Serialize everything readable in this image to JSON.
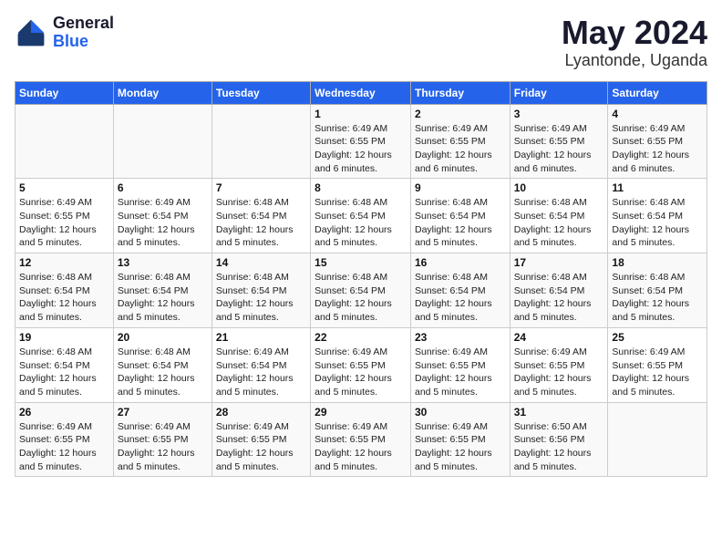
{
  "header": {
    "logo_general": "General",
    "logo_blue": "Blue",
    "title": "May 2024",
    "subtitle": "Lyantonde, Uganda"
  },
  "weekdays": [
    "Sunday",
    "Monday",
    "Tuesday",
    "Wednesday",
    "Thursday",
    "Friday",
    "Saturday"
  ],
  "weeks": [
    [
      {
        "day": "",
        "info": ""
      },
      {
        "day": "",
        "info": ""
      },
      {
        "day": "",
        "info": ""
      },
      {
        "day": "1",
        "info": "Sunrise: 6:49 AM\nSunset: 6:55 PM\nDaylight: 12 hours\nand 6 minutes."
      },
      {
        "day": "2",
        "info": "Sunrise: 6:49 AM\nSunset: 6:55 PM\nDaylight: 12 hours\nand 6 minutes."
      },
      {
        "day": "3",
        "info": "Sunrise: 6:49 AM\nSunset: 6:55 PM\nDaylight: 12 hours\nand 6 minutes."
      },
      {
        "day": "4",
        "info": "Sunrise: 6:49 AM\nSunset: 6:55 PM\nDaylight: 12 hours\nand 6 minutes."
      }
    ],
    [
      {
        "day": "5",
        "info": "Sunrise: 6:49 AM\nSunset: 6:55 PM\nDaylight: 12 hours\nand 5 minutes."
      },
      {
        "day": "6",
        "info": "Sunrise: 6:49 AM\nSunset: 6:54 PM\nDaylight: 12 hours\nand 5 minutes."
      },
      {
        "day": "7",
        "info": "Sunrise: 6:48 AM\nSunset: 6:54 PM\nDaylight: 12 hours\nand 5 minutes."
      },
      {
        "day": "8",
        "info": "Sunrise: 6:48 AM\nSunset: 6:54 PM\nDaylight: 12 hours\nand 5 minutes."
      },
      {
        "day": "9",
        "info": "Sunrise: 6:48 AM\nSunset: 6:54 PM\nDaylight: 12 hours\nand 5 minutes."
      },
      {
        "day": "10",
        "info": "Sunrise: 6:48 AM\nSunset: 6:54 PM\nDaylight: 12 hours\nand 5 minutes."
      },
      {
        "day": "11",
        "info": "Sunrise: 6:48 AM\nSunset: 6:54 PM\nDaylight: 12 hours\nand 5 minutes."
      }
    ],
    [
      {
        "day": "12",
        "info": "Sunrise: 6:48 AM\nSunset: 6:54 PM\nDaylight: 12 hours\nand 5 minutes."
      },
      {
        "day": "13",
        "info": "Sunrise: 6:48 AM\nSunset: 6:54 PM\nDaylight: 12 hours\nand 5 minutes."
      },
      {
        "day": "14",
        "info": "Sunrise: 6:48 AM\nSunset: 6:54 PM\nDaylight: 12 hours\nand 5 minutes."
      },
      {
        "day": "15",
        "info": "Sunrise: 6:48 AM\nSunset: 6:54 PM\nDaylight: 12 hours\nand 5 minutes."
      },
      {
        "day": "16",
        "info": "Sunrise: 6:48 AM\nSunset: 6:54 PM\nDaylight: 12 hours\nand 5 minutes."
      },
      {
        "day": "17",
        "info": "Sunrise: 6:48 AM\nSunset: 6:54 PM\nDaylight: 12 hours\nand 5 minutes."
      },
      {
        "day": "18",
        "info": "Sunrise: 6:48 AM\nSunset: 6:54 PM\nDaylight: 12 hours\nand 5 minutes."
      }
    ],
    [
      {
        "day": "19",
        "info": "Sunrise: 6:48 AM\nSunset: 6:54 PM\nDaylight: 12 hours\nand 5 minutes."
      },
      {
        "day": "20",
        "info": "Sunrise: 6:48 AM\nSunset: 6:54 PM\nDaylight: 12 hours\nand 5 minutes."
      },
      {
        "day": "21",
        "info": "Sunrise: 6:49 AM\nSunset: 6:54 PM\nDaylight: 12 hours\nand 5 minutes."
      },
      {
        "day": "22",
        "info": "Sunrise: 6:49 AM\nSunset: 6:55 PM\nDaylight: 12 hours\nand 5 minutes."
      },
      {
        "day": "23",
        "info": "Sunrise: 6:49 AM\nSunset: 6:55 PM\nDaylight: 12 hours\nand 5 minutes."
      },
      {
        "day": "24",
        "info": "Sunrise: 6:49 AM\nSunset: 6:55 PM\nDaylight: 12 hours\nand 5 minutes."
      },
      {
        "day": "25",
        "info": "Sunrise: 6:49 AM\nSunset: 6:55 PM\nDaylight: 12 hours\nand 5 minutes."
      }
    ],
    [
      {
        "day": "26",
        "info": "Sunrise: 6:49 AM\nSunset: 6:55 PM\nDaylight: 12 hours\nand 5 minutes."
      },
      {
        "day": "27",
        "info": "Sunrise: 6:49 AM\nSunset: 6:55 PM\nDaylight: 12 hours\nand 5 minutes."
      },
      {
        "day": "28",
        "info": "Sunrise: 6:49 AM\nSunset: 6:55 PM\nDaylight: 12 hours\nand 5 minutes."
      },
      {
        "day": "29",
        "info": "Sunrise: 6:49 AM\nSunset: 6:55 PM\nDaylight: 12 hours\nand 5 minutes."
      },
      {
        "day": "30",
        "info": "Sunrise: 6:49 AM\nSunset: 6:55 PM\nDaylight: 12 hours\nand 5 minutes."
      },
      {
        "day": "31",
        "info": "Sunrise: 6:50 AM\nSunset: 6:56 PM\nDaylight: 12 hours\nand 5 minutes."
      },
      {
        "day": "",
        "info": ""
      }
    ]
  ]
}
